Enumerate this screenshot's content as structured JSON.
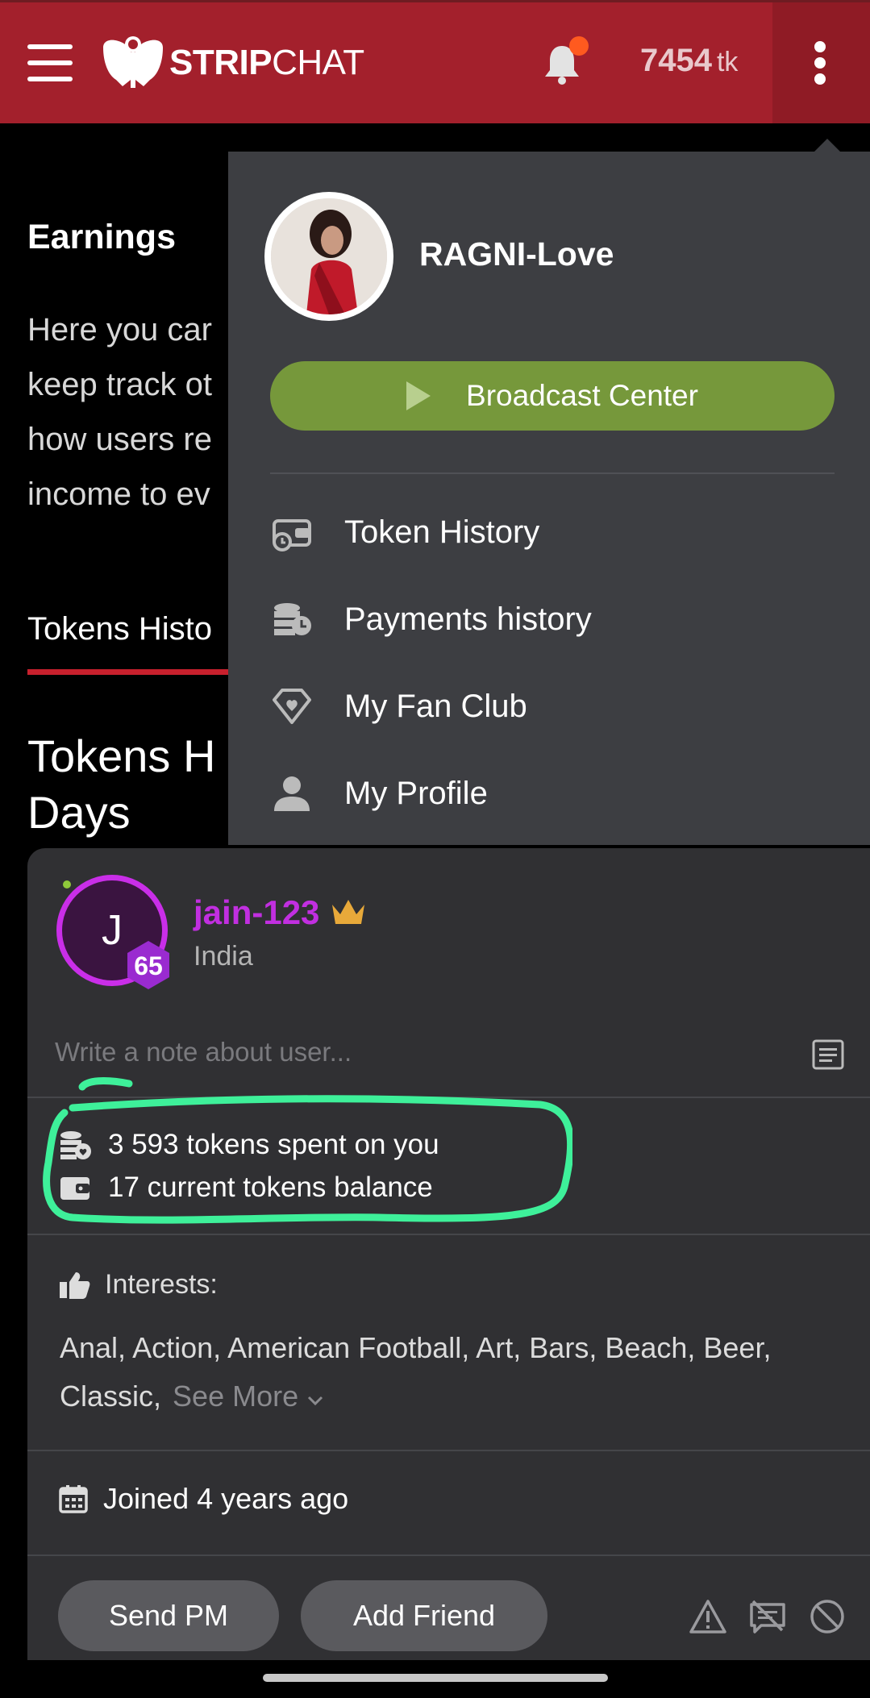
{
  "header": {
    "brand_bold": "STRIP",
    "brand_thin": "CHAT",
    "token_balance": "7454",
    "token_unit": "tk"
  },
  "background_page": {
    "earnings_title": "Earnings",
    "earnings_desc": "Here you car\nkeep track ot\nhow users re\nincome to ev",
    "tab_label": "Tokens Histo",
    "section_heading": "Tokens H\nDays"
  },
  "account_menu": {
    "username": "RAGNI-Love",
    "broadcast_label": "Broadcast Center",
    "items": [
      {
        "label": "Token History",
        "icon": "wallet-clock-icon"
      },
      {
        "label": "Payments history",
        "icon": "coins-clock-icon"
      },
      {
        "label": "My Fan Club",
        "icon": "diamond-heart-icon"
      },
      {
        "label": "My Profile",
        "icon": "person-icon"
      }
    ]
  },
  "user_card": {
    "avatar_letter": "J",
    "level": "65",
    "username": "jain-123",
    "country": "India",
    "note_placeholder": "Write a note about user...",
    "tokens_spent": "3 593 tokens spent on you",
    "tokens_balance": "17 current tokens balance",
    "interests_label": "Interests:",
    "interests_text": "Anal, Action, American Football, Art, Bars, Beach, Beer, Classic,",
    "see_more": "See More",
    "joined": "Joined 4 years ago",
    "send_pm": "Send PM",
    "add_friend": "Add Friend"
  },
  "colors": {
    "header_red": "#a3202c",
    "broadcast_green": "#76983b",
    "username_purple": "#c12fe0",
    "highlight_green": "#3ef09a"
  }
}
